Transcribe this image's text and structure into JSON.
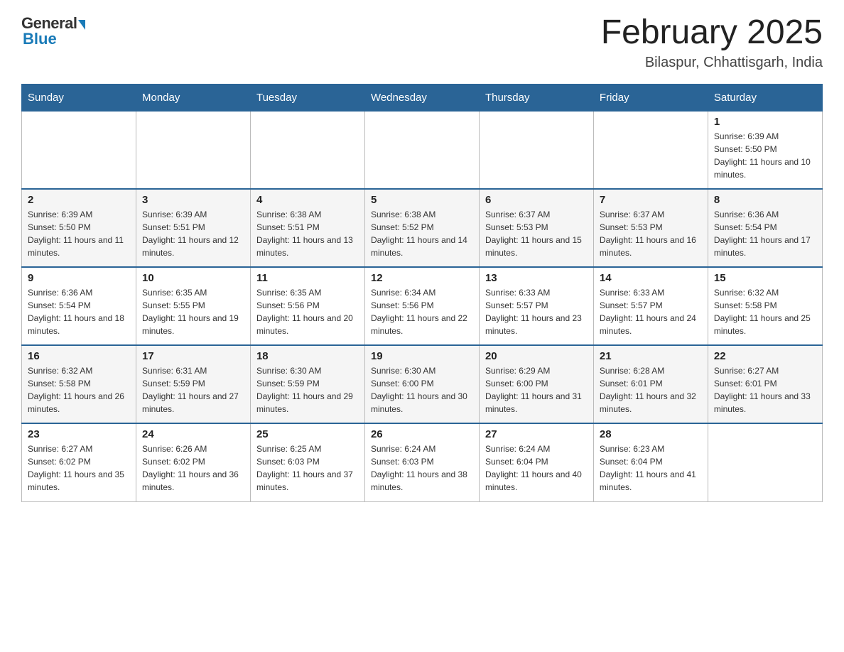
{
  "logo": {
    "general": "General",
    "blue": "Blue"
  },
  "header": {
    "month": "February 2025",
    "location": "Bilaspur, Chhattisgarh, India"
  },
  "days_of_week": [
    "Sunday",
    "Monday",
    "Tuesday",
    "Wednesday",
    "Thursday",
    "Friday",
    "Saturday"
  ],
  "weeks": [
    [
      {
        "num": "",
        "sunrise": "",
        "sunset": "",
        "daylight": ""
      },
      {
        "num": "",
        "sunrise": "",
        "sunset": "",
        "daylight": ""
      },
      {
        "num": "",
        "sunrise": "",
        "sunset": "",
        "daylight": ""
      },
      {
        "num": "",
        "sunrise": "",
        "sunset": "",
        "daylight": ""
      },
      {
        "num": "",
        "sunrise": "",
        "sunset": "",
        "daylight": ""
      },
      {
        "num": "",
        "sunrise": "",
        "sunset": "",
        "daylight": ""
      },
      {
        "num": "1",
        "sunrise": "Sunrise: 6:39 AM",
        "sunset": "Sunset: 5:50 PM",
        "daylight": "Daylight: 11 hours and 10 minutes."
      }
    ],
    [
      {
        "num": "2",
        "sunrise": "Sunrise: 6:39 AM",
        "sunset": "Sunset: 5:50 PM",
        "daylight": "Daylight: 11 hours and 11 minutes."
      },
      {
        "num": "3",
        "sunrise": "Sunrise: 6:39 AM",
        "sunset": "Sunset: 5:51 PM",
        "daylight": "Daylight: 11 hours and 12 minutes."
      },
      {
        "num": "4",
        "sunrise": "Sunrise: 6:38 AM",
        "sunset": "Sunset: 5:51 PM",
        "daylight": "Daylight: 11 hours and 13 minutes."
      },
      {
        "num": "5",
        "sunrise": "Sunrise: 6:38 AM",
        "sunset": "Sunset: 5:52 PM",
        "daylight": "Daylight: 11 hours and 14 minutes."
      },
      {
        "num": "6",
        "sunrise": "Sunrise: 6:37 AM",
        "sunset": "Sunset: 5:53 PM",
        "daylight": "Daylight: 11 hours and 15 minutes."
      },
      {
        "num": "7",
        "sunrise": "Sunrise: 6:37 AM",
        "sunset": "Sunset: 5:53 PM",
        "daylight": "Daylight: 11 hours and 16 minutes."
      },
      {
        "num": "8",
        "sunrise": "Sunrise: 6:36 AM",
        "sunset": "Sunset: 5:54 PM",
        "daylight": "Daylight: 11 hours and 17 minutes."
      }
    ],
    [
      {
        "num": "9",
        "sunrise": "Sunrise: 6:36 AM",
        "sunset": "Sunset: 5:54 PM",
        "daylight": "Daylight: 11 hours and 18 minutes."
      },
      {
        "num": "10",
        "sunrise": "Sunrise: 6:35 AM",
        "sunset": "Sunset: 5:55 PM",
        "daylight": "Daylight: 11 hours and 19 minutes."
      },
      {
        "num": "11",
        "sunrise": "Sunrise: 6:35 AM",
        "sunset": "Sunset: 5:56 PM",
        "daylight": "Daylight: 11 hours and 20 minutes."
      },
      {
        "num": "12",
        "sunrise": "Sunrise: 6:34 AM",
        "sunset": "Sunset: 5:56 PM",
        "daylight": "Daylight: 11 hours and 22 minutes."
      },
      {
        "num": "13",
        "sunrise": "Sunrise: 6:33 AM",
        "sunset": "Sunset: 5:57 PM",
        "daylight": "Daylight: 11 hours and 23 minutes."
      },
      {
        "num": "14",
        "sunrise": "Sunrise: 6:33 AM",
        "sunset": "Sunset: 5:57 PM",
        "daylight": "Daylight: 11 hours and 24 minutes."
      },
      {
        "num": "15",
        "sunrise": "Sunrise: 6:32 AM",
        "sunset": "Sunset: 5:58 PM",
        "daylight": "Daylight: 11 hours and 25 minutes."
      }
    ],
    [
      {
        "num": "16",
        "sunrise": "Sunrise: 6:32 AM",
        "sunset": "Sunset: 5:58 PM",
        "daylight": "Daylight: 11 hours and 26 minutes."
      },
      {
        "num": "17",
        "sunrise": "Sunrise: 6:31 AM",
        "sunset": "Sunset: 5:59 PM",
        "daylight": "Daylight: 11 hours and 27 minutes."
      },
      {
        "num": "18",
        "sunrise": "Sunrise: 6:30 AM",
        "sunset": "Sunset: 5:59 PM",
        "daylight": "Daylight: 11 hours and 29 minutes."
      },
      {
        "num": "19",
        "sunrise": "Sunrise: 6:30 AM",
        "sunset": "Sunset: 6:00 PM",
        "daylight": "Daylight: 11 hours and 30 minutes."
      },
      {
        "num": "20",
        "sunrise": "Sunrise: 6:29 AM",
        "sunset": "Sunset: 6:00 PM",
        "daylight": "Daylight: 11 hours and 31 minutes."
      },
      {
        "num": "21",
        "sunrise": "Sunrise: 6:28 AM",
        "sunset": "Sunset: 6:01 PM",
        "daylight": "Daylight: 11 hours and 32 minutes."
      },
      {
        "num": "22",
        "sunrise": "Sunrise: 6:27 AM",
        "sunset": "Sunset: 6:01 PM",
        "daylight": "Daylight: 11 hours and 33 minutes."
      }
    ],
    [
      {
        "num": "23",
        "sunrise": "Sunrise: 6:27 AM",
        "sunset": "Sunset: 6:02 PM",
        "daylight": "Daylight: 11 hours and 35 minutes."
      },
      {
        "num": "24",
        "sunrise": "Sunrise: 6:26 AM",
        "sunset": "Sunset: 6:02 PM",
        "daylight": "Daylight: 11 hours and 36 minutes."
      },
      {
        "num": "25",
        "sunrise": "Sunrise: 6:25 AM",
        "sunset": "Sunset: 6:03 PM",
        "daylight": "Daylight: 11 hours and 37 minutes."
      },
      {
        "num": "26",
        "sunrise": "Sunrise: 6:24 AM",
        "sunset": "Sunset: 6:03 PM",
        "daylight": "Daylight: 11 hours and 38 minutes."
      },
      {
        "num": "27",
        "sunrise": "Sunrise: 6:24 AM",
        "sunset": "Sunset: 6:04 PM",
        "daylight": "Daylight: 11 hours and 40 minutes."
      },
      {
        "num": "28",
        "sunrise": "Sunrise: 6:23 AM",
        "sunset": "Sunset: 6:04 PM",
        "daylight": "Daylight: 11 hours and 41 minutes."
      },
      {
        "num": "",
        "sunrise": "",
        "sunset": "",
        "daylight": ""
      }
    ]
  ]
}
